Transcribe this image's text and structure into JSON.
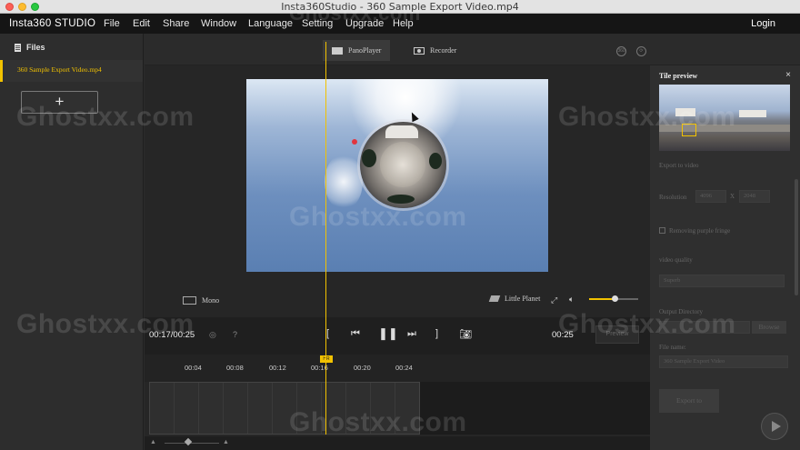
{
  "window": {
    "title": "Insta360Studio - 360 Sample Export Video.mp4"
  },
  "menubar": {
    "brand": "Insta360 STUDIO",
    "items": [
      "File",
      "Edit",
      "Share",
      "Window",
      "Language",
      "Setting",
      "Upgrade",
      "Help"
    ],
    "login": "Login"
  },
  "files": {
    "header": "Files",
    "items": [
      {
        "name": "360 Sample Export Video.mp4",
        "selected": true
      }
    ],
    "add_symbol": "+"
  },
  "tabs": [
    {
      "label": "PanoPlayer",
      "active": true
    },
    {
      "label": "Recorder",
      "active": false
    }
  ],
  "viewer": {
    "mono_label": "Mono",
    "view_mode": "Little Planet",
    "volume_fraction": 0.52
  },
  "transport": {
    "current_time": "00:17/00:25",
    "help": "?",
    "in_mark": "[",
    "out_mark": "]",
    "end_time": "00:25",
    "preview_label": "Preview"
  },
  "timeline": {
    "ticks": [
      "00:04",
      "00:08",
      "00:12",
      "00:16",
      "00:20",
      "00:24"
    ],
    "playhead_label": "HR"
  },
  "tile_preview": {
    "title": "Tile preview",
    "close": "×",
    "export_to_video": "Export to video",
    "resolution_label": "Resolution",
    "width": "4096",
    "x_sep": "X",
    "height": "2048",
    "purple_fringe": "Removing purple fringe",
    "quality_label": "video quality",
    "quality_value": "Superb",
    "output_dir_label": "Output Directory",
    "browse": "Browse",
    "file_name_label": "File name:",
    "file_name_value": "360 Sample Export Video",
    "export_button": "Export to"
  },
  "watermark": "Ghostxx.com",
  "colors": {
    "accent": "#f2c200",
    "menubar": "#151515",
    "panel": "#2d2d2d"
  }
}
